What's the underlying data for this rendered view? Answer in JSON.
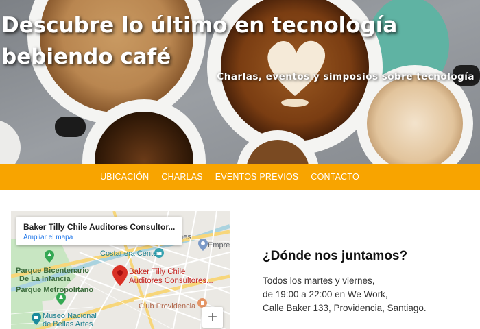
{
  "hero": {
    "title_line1": "Descubre lo último en tecnología",
    "title_line2": "bebiendo café",
    "subtitle": "Charlas, eventos y simposios sobre tecnología"
  },
  "nav": {
    "items": [
      "UBICACIÓN",
      "CHARLAS",
      "EVENTOS PREVIOS",
      "CONTACTO"
    ]
  },
  "map": {
    "card_title": "Baker Tilly Chile Auditores Consultor...",
    "card_link": "Ampliar el mapa",
    "labels": {
      "ones": "ones",
      "empres": "Empres",
      "costanera": "Costanera Center",
      "parque_line1": "Parque Bicentenario",
      "parque_line2": "De La Infancia",
      "metropolitano": "Parque Metropolitano",
      "pin_line1": "Baker Tilly Chile",
      "pin_line2": "Auditores Consultores...",
      "club": "Club Providencia",
      "museo_line1": "Museo Nacional",
      "museo_line2": "de Bellas Artes"
    },
    "zoom_in": "+"
  },
  "info": {
    "title": "¿Dónde nos juntamos?",
    "line1": "Todos los martes y viernes,",
    "line2": "de 19:00 a 22:00 en We Work,",
    "line3": "Calle Baker 133, Providencia, Santiago."
  },
  "colors": {
    "nav_background": "#f8a400",
    "map_pin": "#d93025",
    "link": "#1a73e8"
  },
  "icons": [
    "pin-icon",
    "park-icon",
    "museum-icon",
    "tree-icon",
    "camera-icon",
    "info-icon",
    "plus-icon"
  ]
}
